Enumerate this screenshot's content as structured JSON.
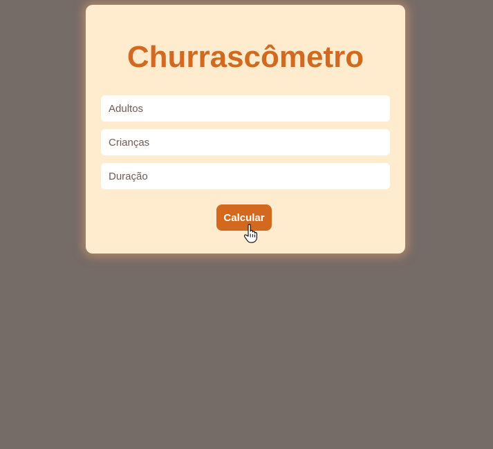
{
  "app": {
    "title": "Churrascômetro"
  },
  "form": {
    "adults_placeholder": "Adultos",
    "children_placeholder": "Crianças",
    "duration_placeholder": "Duração",
    "calculate_label": "Calcular"
  },
  "colors": {
    "page_background": "#756b67",
    "card_background": "#ffebcd",
    "accent": "#d2691e"
  },
  "icons": {
    "cursor": "hand-pointer-icon"
  }
}
